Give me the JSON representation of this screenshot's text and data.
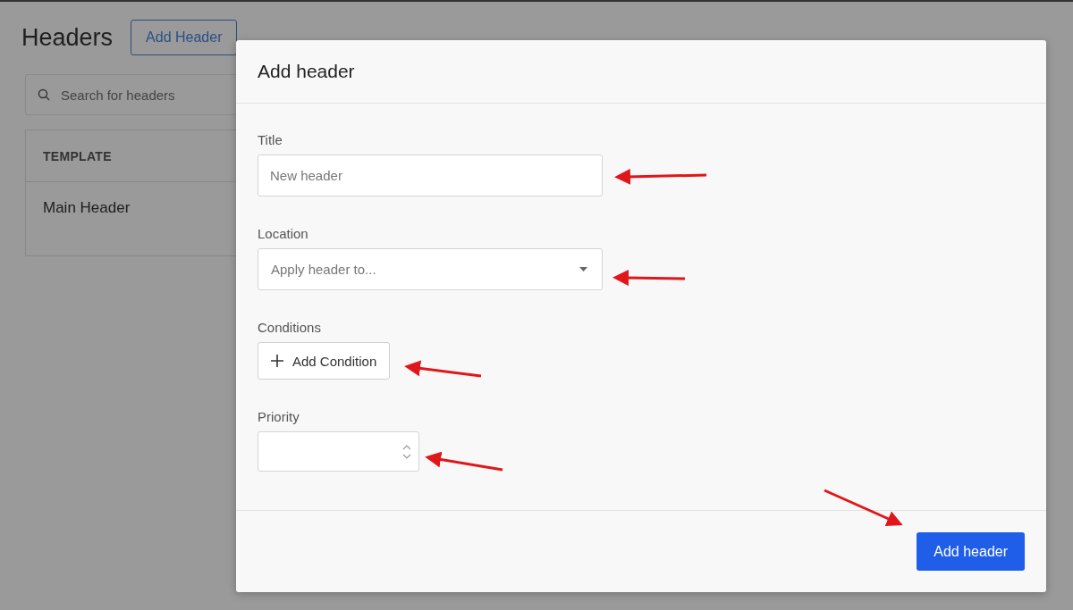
{
  "page": {
    "title": "Headers",
    "add_button": "Add Header",
    "search": {
      "placeholder": "Search for headers"
    },
    "table": {
      "columns": [
        "TEMPLATE"
      ],
      "rows": [
        [
          "Main Header"
        ]
      ]
    }
  },
  "dialog": {
    "title": "Add header",
    "fields": [
      {
        "kind": "text",
        "label": "Title",
        "placeholder": "New header"
      },
      {
        "kind": "select",
        "label": "Location",
        "placeholder": "Apply header to..."
      },
      {
        "kind": "button",
        "label": "Conditions",
        "button": "Add Condition"
      },
      {
        "kind": "number",
        "label": "Priority"
      }
    ],
    "submit": "Add header"
  }
}
